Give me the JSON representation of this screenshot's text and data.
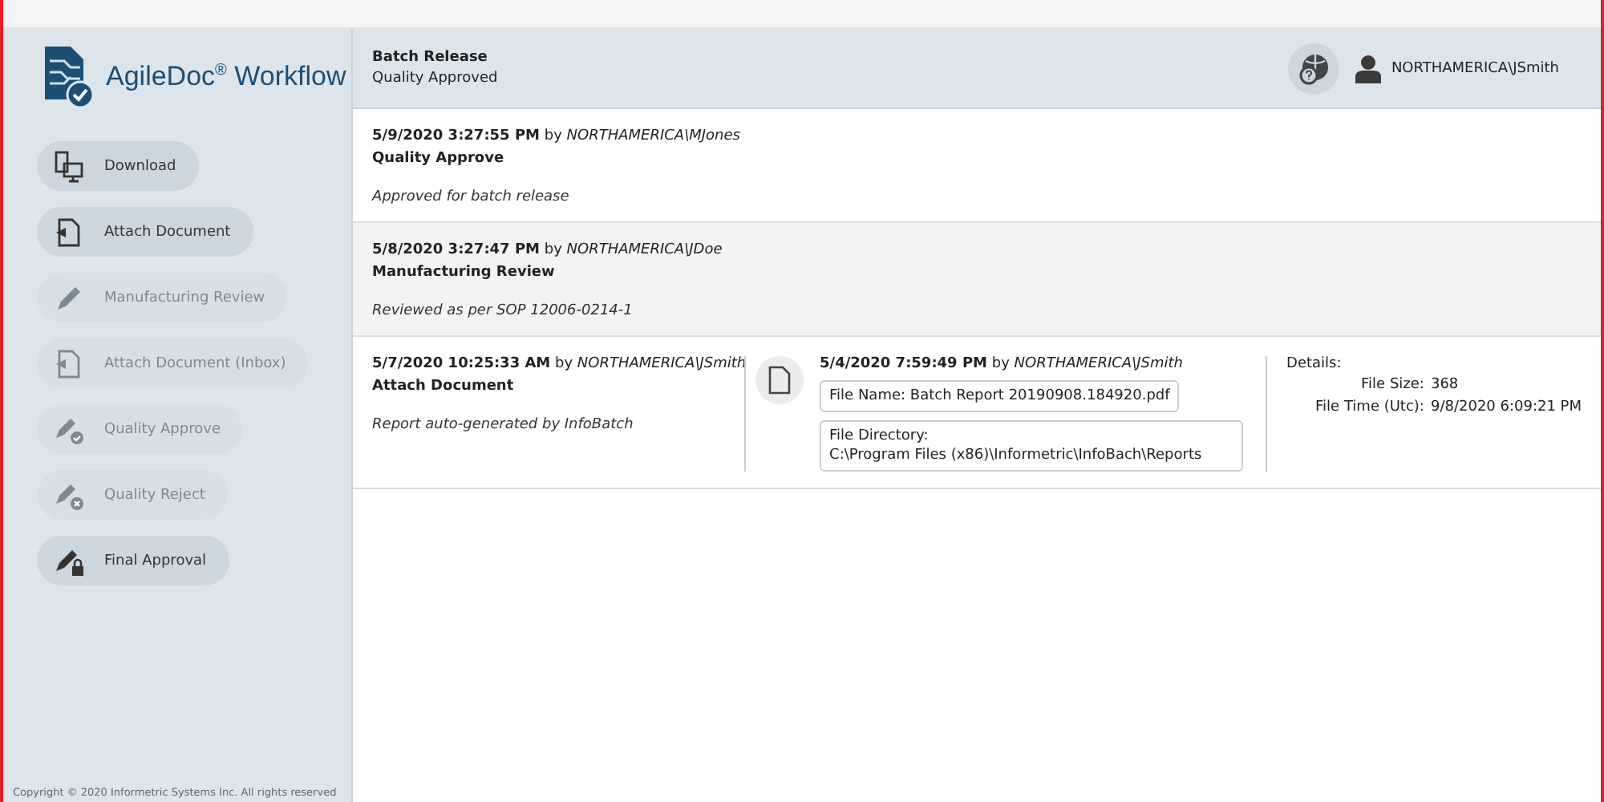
{
  "app": {
    "logo_text": "AgileDoc",
    "logo_mark": "®",
    "logo_suffix": "Workflow"
  },
  "sidebar": {
    "actions": [
      {
        "label": "Download",
        "kind": "download",
        "disabled": false
      },
      {
        "label": "Attach Document",
        "kind": "attach",
        "disabled": false
      },
      {
        "label": "Manufacturing Review",
        "kind": "review",
        "disabled": true
      },
      {
        "label": "Attach Document (Inbox)",
        "kind": "attach",
        "disabled": true
      },
      {
        "label": "Quality Approve",
        "kind": "approve",
        "disabled": true
      },
      {
        "label": "Quality Reject",
        "kind": "reject",
        "disabled": true
      },
      {
        "label": "Final Approval",
        "kind": "final",
        "disabled": false
      }
    ],
    "copyright": "Copyright © 2020 Informetric Systems Inc. All rights reserved"
  },
  "header": {
    "title": "Batch Release",
    "status": "Quality Approved",
    "user": "NORTHAMERICA\\JSmith"
  },
  "entries": [
    {
      "timestamp": "5/9/2020 3:27:55 PM",
      "by": "by",
      "user": "NORTHAMERICA\\MJones",
      "action": "Quality Approve",
      "comment": "Approved for batch release",
      "selected": false
    },
    {
      "timestamp": "5/8/2020 3:27:47 PM",
      "by": "by",
      "user": "NORTHAMERICA\\JDoe",
      "action": "Manufacturing Review",
      "comment": "Reviewed as per SOP 12006-0214-1",
      "selected": true
    },
    {
      "timestamp": "5/7/2020 10:25:33 AM",
      "by": "by",
      "user": "NORTHAMERICA\\JSmith",
      "action": "Attach Document",
      "comment": "Report auto-generated by InfoBatch",
      "selected": false,
      "attachment": {
        "timestamp": "5/4/2020 7:59:49 PM",
        "by": "by",
        "user": "NORTHAMERICA\\JSmith",
        "file_name_label": "File Name:",
        "file_name": "Batch Report 20190908.184920.pdf",
        "dir_label": "File Directory:",
        "directory": "C:\\Program Files (x86)\\Informetric\\InfoBach\\Reports",
        "details_label": "Details:",
        "details": [
          {
            "label": "File Size:",
            "value": "368"
          },
          {
            "label": "File Time (Utc):",
            "value": "9/8/2020 6:09:21 PM"
          }
        ]
      }
    }
  ]
}
